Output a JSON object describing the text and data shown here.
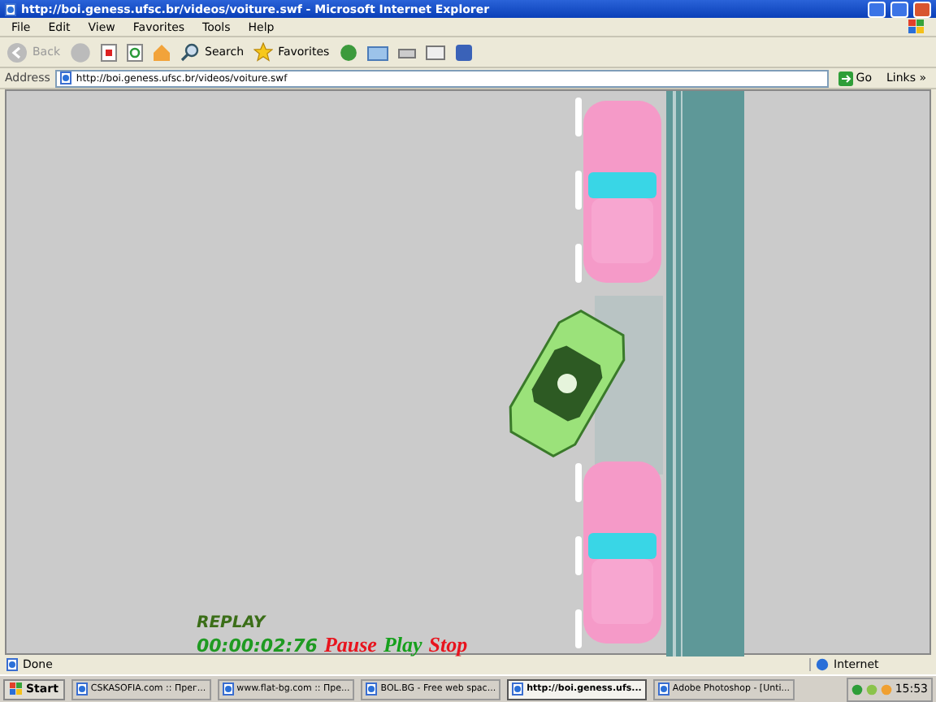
{
  "window": {
    "title": "http://boi.geness.ufsc.br/videos/voiture.swf - Microsoft Internet Explorer"
  },
  "menu": [
    "File",
    "Edit",
    "View",
    "Favorites",
    "Tools",
    "Help"
  ],
  "toolbar": [
    {
      "kind": "back",
      "label": "Back",
      "disabled": true
    },
    {
      "kind": "search",
      "label": "Search",
      "disabled": false
    },
    {
      "kind": "favorites",
      "label": "Favorites",
      "disabled": false
    }
  ],
  "address_bar": {
    "label": "Address",
    "url": "http://boi.geness.ufsc.br/videos/voiture.swf",
    "go": "Go",
    "links": "Links",
    "more": "»"
  },
  "player": {
    "replay": "REPLAY",
    "time": "00:00:02:76",
    "controls": [
      {
        "label": "Pause",
        "color": "#e8141e"
      },
      {
        "label": "Play",
        "color": "#16a01c"
      },
      {
        "label": "Stop",
        "color": "#e8141e"
      }
    ]
  },
  "status_bar": {
    "text": "Done",
    "zone": "Internet"
  },
  "taskbar": {
    "start": "Start",
    "clock": "15:53",
    "items": [
      {
        "label": "CSKASOFIA.com :: Прег...",
        "selected": false
      },
      {
        "label": "www.flat-bg.com :: Пре...",
        "selected": false
      },
      {
        "label": "BOL.BG - Free web spac...",
        "selected": false
      },
      {
        "label": "http://boi.geness.ufs...",
        "selected": true
      },
      {
        "label": "Adobe Photoshop - [Unti...",
        "selected": false
      }
    ]
  }
}
